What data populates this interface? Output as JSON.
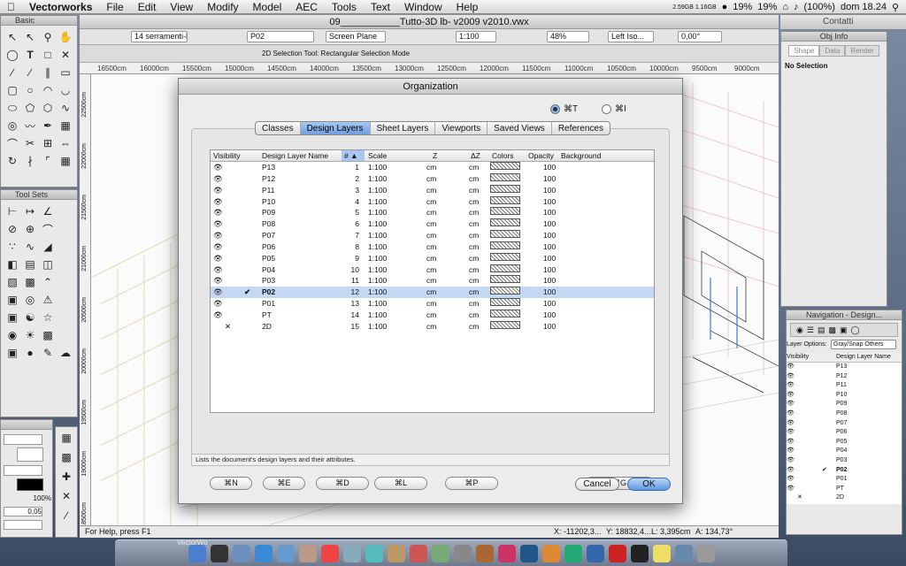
{
  "menubar": {
    "apple": "",
    "app": "Vectorworks",
    "items": [
      "File",
      "Edit",
      "View",
      "Modify",
      "Model",
      "AEC",
      "Tools",
      "Text",
      "Window",
      "Help"
    ],
    "status": {
      "memory": "2.59GB 1.16GB",
      "cpu1": "19%",
      "cpu2": "19%",
      "battery": "(100%)",
      "clock": "dom 18.24"
    }
  },
  "window": {
    "title": "09___________Tutto-3D lb- v2009 v2010.vwx"
  },
  "toolbar1": {
    "saved_view": "14 serramenti-br...",
    "layer": "P02",
    "plane": "Screen Plane",
    "scale": "1:100",
    "zoom": "48%",
    "view": "Left Iso...",
    "angle": "0,00°"
  },
  "toolbar2": {
    "mode_text": "2D Selection Tool: Rectangular Selection Mode"
  },
  "ruler": {
    "marks": [
      "16500cm",
      "16000cm",
      "15500cm",
      "15000cm",
      "14500cm",
      "14000cm",
      "13500cm",
      "13000cm",
      "12500cm",
      "12000cm",
      "11500cm",
      "11000cm",
      "10500cm",
      "10000cm",
      "9500cm",
      "9000cm"
    ]
  },
  "vruler": {
    "marks": [
      "22500cm",
      "22000cm",
      "21500cm",
      "21000cm",
      "20500cm",
      "20000cm",
      "19500cm",
      "19000cm",
      "18500cm"
    ]
  },
  "status": {
    "help": "For Help, press F1",
    "x": "X: -11202,3...",
    "y": "Y: 18832,4...",
    "l": "L: 3,395cm",
    "a": "A: 134,73°"
  },
  "palettes": {
    "basic": {
      "title": "Basic"
    },
    "toolsets": {
      "title": "Tool Sets"
    },
    "attributes": {
      "lineweight": "100%",
      "thickness": "0,05"
    },
    "contatti": {
      "title": "Contatti"
    }
  },
  "objinfo": {
    "title": "Obj Info",
    "tabs": [
      "Shape",
      "Data",
      "Render"
    ],
    "selection": "No Selection"
  },
  "navigation": {
    "title": "Navigation - Design...",
    "options_label": "Layer Options:",
    "options_value": "Gray/Snap Others",
    "col_visibility": "Visibility",
    "col_name": "Design Layer Name",
    "layers": [
      "P13",
      "P12",
      "P11",
      "P10",
      "P09",
      "P08",
      "P07",
      "P06",
      "P05",
      "P04",
      "P03",
      "P02",
      "P01",
      "PT",
      "2D"
    ]
  },
  "dialog": {
    "title": "Organization",
    "radio1": "⌘T",
    "radio2": "⌘I",
    "tabs": [
      "Classes",
      "Design Layers",
      "Sheet Layers",
      "Viewports",
      "Saved Views",
      "References"
    ],
    "columns": {
      "visibility": "Visibility",
      "name": "Design Layer Name",
      "num": "#",
      "scale": "Scale",
      "z": "Z",
      "dz": "ΔZ",
      "colors": "Colors",
      "opacity": "Opacity",
      "background": "Background"
    },
    "rows": [
      {
        "vis": "eye",
        "check": "",
        "name": "P13",
        "num": "1",
        "scale": "1:100",
        "z": "cm",
        "dz": "cm",
        "opacity": "100",
        "selected": false
      },
      {
        "vis": "eye",
        "check": "",
        "name": "P12",
        "num": "2",
        "scale": "1:100",
        "z": "cm",
        "dz": "cm",
        "opacity": "100",
        "selected": false
      },
      {
        "vis": "eye",
        "check": "",
        "name": "P11",
        "num": "3",
        "scale": "1:100",
        "z": "cm",
        "dz": "cm",
        "opacity": "100",
        "selected": false
      },
      {
        "vis": "eye",
        "check": "",
        "name": "P10",
        "num": "4",
        "scale": "1:100",
        "z": "cm",
        "dz": "cm",
        "opacity": "100",
        "selected": false
      },
      {
        "vis": "eye",
        "check": "",
        "name": "P09",
        "num": "5",
        "scale": "1:100",
        "z": "cm",
        "dz": "cm",
        "opacity": "100",
        "selected": false
      },
      {
        "vis": "eye",
        "check": "",
        "name": "P08",
        "num": "6",
        "scale": "1:100",
        "z": "cm",
        "dz": "cm",
        "opacity": "100",
        "selected": false
      },
      {
        "vis": "eye",
        "check": "",
        "name": "P07",
        "num": "7",
        "scale": "1:100",
        "z": "cm",
        "dz": "cm",
        "opacity": "100",
        "selected": false
      },
      {
        "vis": "eye",
        "check": "",
        "name": "P06",
        "num": "8",
        "scale": "1:100",
        "z": "cm",
        "dz": "cm",
        "opacity": "100",
        "selected": false
      },
      {
        "vis": "eye",
        "check": "",
        "name": "P05",
        "num": "9",
        "scale": "1:100",
        "z": "cm",
        "dz": "cm",
        "opacity": "100",
        "selected": false
      },
      {
        "vis": "eye",
        "check": "",
        "name": "P04",
        "num": "10",
        "scale": "1:100",
        "z": "cm",
        "dz": "cm",
        "opacity": "100",
        "selected": false
      },
      {
        "vis": "eye",
        "check": "",
        "name": "P03",
        "num": "11",
        "scale": "1:100",
        "z": "cm",
        "dz": "cm",
        "opacity": "100",
        "selected": false
      },
      {
        "vis": "eye",
        "check": "✔",
        "name": "P02",
        "num": "12",
        "scale": "1:100",
        "z": "cm",
        "dz": "cm",
        "opacity": "100",
        "selected": true
      },
      {
        "vis": "eye",
        "check": "",
        "name": "P01",
        "num": "13",
        "scale": "1:100",
        "z": "cm",
        "dz": "cm",
        "opacity": "100",
        "selected": false
      },
      {
        "vis": "eye",
        "check": "",
        "name": "PT",
        "num": "14",
        "scale": "1:100",
        "z": "cm",
        "dz": "cm",
        "opacity": "100",
        "selected": false
      },
      {
        "vis": "x",
        "check": "",
        "name": "2D",
        "num": "15",
        "scale": "1:100",
        "z": "cm",
        "dz": "cm",
        "opacity": "100",
        "selected": false
      }
    ],
    "buttons": [
      "⌘N",
      "⌘E",
      "⌘D",
      "⌘L",
      "⌘P",
      "⌘G"
    ],
    "description": "Lists the document's design layers and their attributes.",
    "cancel": "Cancel",
    "ok": "OK"
  },
  "dock": {
    "items": [
      "Finder",
      "Dashboard",
      "Mail",
      "Safari",
      "iChat",
      "Address Book",
      "iCal",
      "Preview",
      "iTunes",
      "iPhoto",
      "Photo Booth",
      "Time Machine",
      "System Preferences",
      "Bridge",
      "InDesign",
      "Photoshop",
      "Illustrator",
      "Dreamweaver",
      "Vectorworks",
      "Acrobat",
      "Terminal",
      "Stickies",
      "Downloads",
      "Trash"
    ],
    "label": "VectorWo"
  },
  "colors": {
    "accent": "#5d98e3",
    "selection": "#c4d8f3"
  }
}
